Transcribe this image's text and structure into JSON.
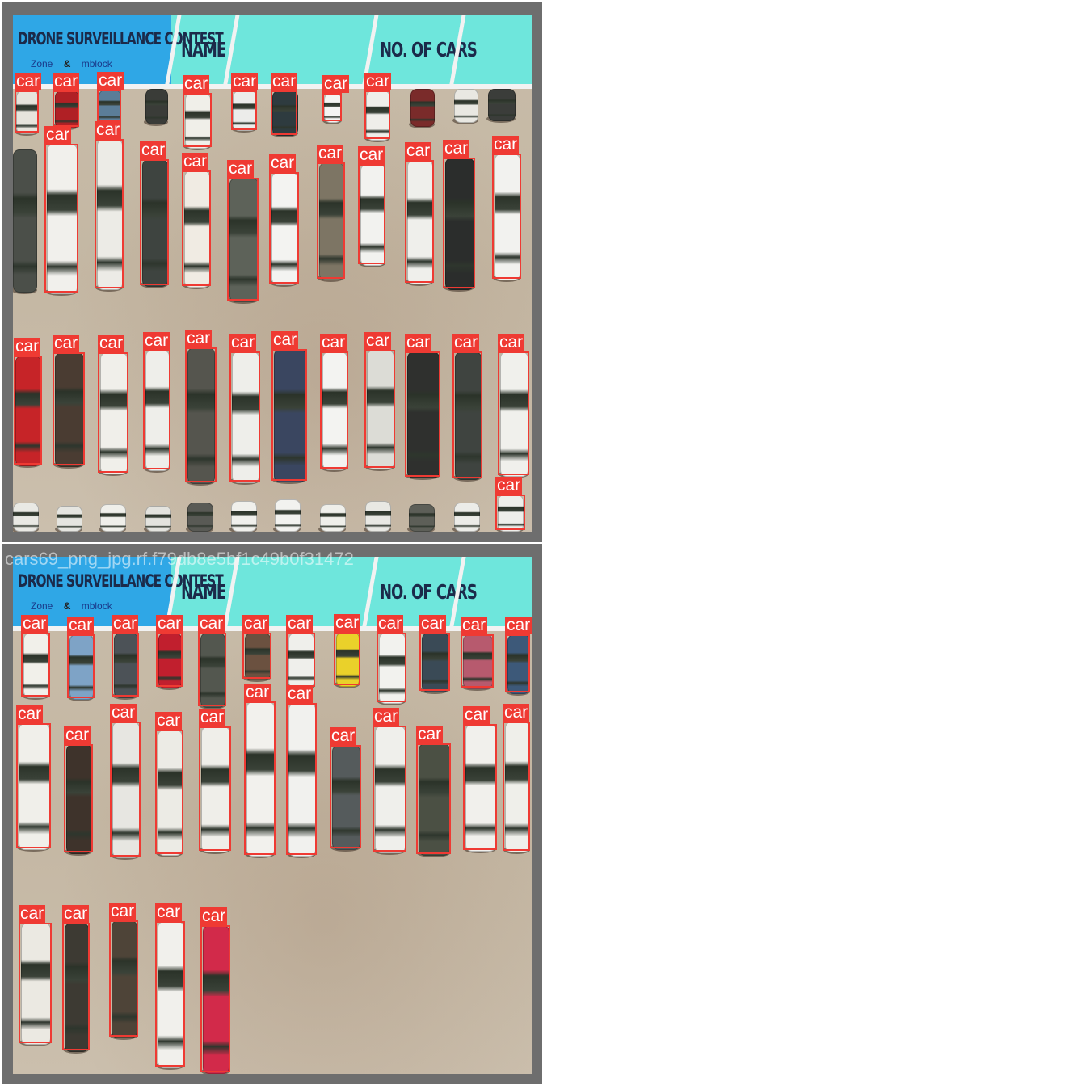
{
  "banner": {
    "title": "DRONE SURVEILLANCE CONTEST",
    "name_label": "NAME",
    "count_label": "NO. OF CARS",
    "logo_left": "Zone",
    "logo_sep": "&",
    "logo_right": "mblock"
  },
  "detection_label": "car",
  "bottom_caption": "cars69_png_jpg.rf.f79db8e5bf1c49b0f31472",
  "colors": {
    "box": "#ef3a33",
    "label_text": "#ffffff",
    "frame": "#6e6e6e"
  },
  "panels": [
    {
      "id": "top",
      "detections": [
        [
          18,
          112,
          48,
          164
        ],
        [
          65,
          112,
          98,
          157
        ],
        [
          120,
          111,
          150,
          151
        ],
        [
          226,
          115,
          262,
          182
        ],
        [
          286,
          112,
          318,
          161
        ],
        [
          335,
          112,
          368,
          167
        ],
        [
          399,
          115,
          423,
          150
        ],
        [
          451,
          112,
          483,
          172
        ],
        [
          55,
          178,
          97,
          362
        ],
        [
          117,
          172,
          153,
          357
        ],
        [
          173,
          197,
          209,
          353
        ],
        [
          225,
          211,
          261,
          354
        ],
        [
          281,
          220,
          320,
          372
        ],
        [
          333,
          213,
          370,
          351
        ],
        [
          392,
          201,
          427,
          345
        ],
        [
          443,
          203,
          477,
          327
        ],
        [
          501,
          198,
          537,
          350
        ],
        [
          548,
          195,
          588,
          357
        ],
        [
          609,
          190,
          645,
          345
        ],
        [
          17,
          440,
          52,
          575
        ],
        [
          65,
          436,
          105,
          576
        ],
        [
          121,
          436,
          159,
          585
        ],
        [
          177,
          433,
          211,
          581
        ],
        [
          229,
          430,
          268,
          597
        ],
        [
          284,
          435,
          322,
          596
        ],
        [
          336,
          432,
          380,
          595
        ],
        [
          396,
          435,
          431,
          580
        ],
        [
          451,
          433,
          489,
          579
        ],
        [
          501,
          435,
          545,
          590
        ],
        [
          560,
          435,
          597,
          592
        ],
        [
          616,
          435,
          655,
          588
        ],
        [
          613,
          612,
          650,
          656
        ]
      ],
      "cars": [
        [
          20,
          112,
          26,
          52,
          "#e7e4dc"
        ],
        [
          68,
          112,
          28,
          45,
          "#b02025"
        ],
        [
          122,
          111,
          26,
          40,
          "#5b7d98"
        ],
        [
          180,
          110,
          26,
          42,
          "#3a3c38"
        ],
        [
          229,
          115,
          30,
          67,
          "#f0efe9"
        ],
        [
          288,
          112,
          28,
          48,
          "#ececea"
        ],
        [
          337,
          112,
          30,
          54,
          "#2e3b3f"
        ],
        [
          401,
          115,
          20,
          35,
          "#f4f4f2"
        ],
        [
          453,
          112,
          28,
          60,
          "#efeeea"
        ],
        [
          508,
          110,
          28,
          45,
          "#7a2b2a"
        ],
        [
          562,
          110,
          28,
          40,
          "#e9e8e2"
        ],
        [
          604,
          110,
          32,
          38,
          "#3b3d3a"
        ],
        [
          16,
          185,
          28,
          175,
          "#4b4f49"
        ],
        [
          58,
          178,
          36,
          184,
          "#f1f0ec"
        ],
        [
          120,
          172,
          30,
          185,
          "#ecebe6"
        ],
        [
          176,
          197,
          30,
          156,
          "#3e4440"
        ],
        [
          228,
          211,
          30,
          143,
          "#f0ebe3"
        ],
        [
          284,
          220,
          34,
          152,
          "#5d6259"
        ],
        [
          336,
          213,
          31,
          138,
          "#f3f3f1"
        ],
        [
          395,
          201,
          29,
          144,
          "#7d7564"
        ],
        [
          446,
          203,
          29,
          124,
          "#f2f2ef"
        ],
        [
          504,
          198,
          30,
          152,
          "#efefeb"
        ],
        [
          551,
          195,
          34,
          162,
          "#2b2d2c"
        ],
        [
          612,
          190,
          30,
          155,
          "#f2f2ef"
        ],
        [
          19,
          440,
          30,
          135,
          "#c62428"
        ],
        [
          68,
          436,
          34,
          140,
          "#4a3c32"
        ],
        [
          124,
          436,
          32,
          149,
          "#f0efea"
        ],
        [
          180,
          433,
          28,
          148,
          "#eeeeea"
        ],
        [
          232,
          430,
          32,
          167,
          "#55554e"
        ],
        [
          287,
          435,
          32,
          161,
          "#eeeeea"
        ],
        [
          339,
          432,
          38,
          163,
          "#3a4660"
        ],
        [
          399,
          435,
          29,
          145,
          "#f3f3f1"
        ],
        [
          454,
          433,
          32,
          146,
          "#dcdcd6"
        ],
        [
          504,
          435,
          38,
          155,
          "#2f302e"
        ],
        [
          563,
          435,
          31,
          157,
          "#3f4440"
        ],
        [
          619,
          435,
          33,
          153,
          "#f0f0ec"
        ],
        [
          16,
          622,
          30,
          34,
          "#e9e9e4"
        ],
        [
          70,
          626,
          30,
          30,
          "#e5e5e0"
        ],
        [
          124,
          624,
          30,
          32,
          "#efefea"
        ],
        [
          180,
          626,
          30,
          30,
          "#e3e3de"
        ],
        [
          232,
          622,
          30,
          34,
          "#595a55"
        ],
        [
          286,
          620,
          30,
          36,
          "#f0f0ec"
        ],
        [
          340,
          618,
          30,
          38,
          "#f2f2ef"
        ],
        [
          396,
          624,
          30,
          32,
          "#efefea"
        ],
        [
          452,
          620,
          30,
          36,
          "#e8e8e3"
        ],
        [
          506,
          624,
          30,
          32,
          "#5d5f58"
        ],
        [
          562,
          622,
          30,
          34,
          "#ecece8"
        ],
        [
          616,
          612,
          30,
          44,
          "#eeeeea"
        ]
      ]
    },
    {
      "id": "bottom",
      "detections": [
        [
          26,
          783,
          62,
          862
        ],
        [
          83,
          785,
          117,
          864
        ],
        [
          138,
          783,
          172,
          862
        ],
        [
          193,
          783,
          226,
          850
        ],
        [
          245,
          783,
          280,
          874
        ],
        [
          300,
          783,
          336,
          840
        ],
        [
          354,
          783,
          390,
          850
        ],
        [
          413,
          782,
          446,
          848
        ],
        [
          466,
          783,
          503,
          869
        ],
        [
          519,
          783,
          557,
          855
        ],
        [
          570,
          785,
          611,
          851
        ],
        [
          625,
          785,
          656,
          857
        ],
        [
          20,
          895,
          63,
          1050
        ],
        [
          79,
          921,
          115,
          1055
        ],
        [
          136,
          893,
          174,
          1060
        ],
        [
          192,
          903,
          227,
          1057
        ],
        [
          246,
          899,
          286,
          1053
        ],
        [
          302,
          868,
          341,
          1058
        ],
        [
          354,
          870,
          392,
          1058
        ],
        [
          408,
          922,
          447,
          1050
        ],
        [
          461,
          898,
          503,
          1054
        ],
        [
          515,
          920,
          558,
          1057
        ],
        [
          573,
          896,
          615,
          1052
        ],
        [
          622,
          893,
          656,
          1053
        ],
        [
          23,
          1142,
          64,
          1291
        ],
        [
          77,
          1142,
          111,
          1300
        ],
        [
          135,
          1139,
          171,
          1283
        ],
        [
          192,
          1140,
          229,
          1320
        ],
        [
          248,
          1145,
          285,
          1327
        ]
      ],
      "cars": [
        [
          29,
          783,
          30,
          79,
          "#f1f0ea"
        ],
        [
          86,
          785,
          28,
          79,
          "#7ea3c6"
        ],
        [
          141,
          783,
          28,
          79,
          "#4c5257"
        ],
        [
          196,
          783,
          27,
          67,
          "#c11f2e"
        ],
        [
          248,
          783,
          29,
          91,
          "#53574f"
        ],
        [
          303,
          783,
          30,
          57,
          "#6b5140"
        ],
        [
          357,
          783,
          30,
          67,
          "#efefeb"
        ],
        [
          416,
          782,
          27,
          66,
          "#ead12a"
        ],
        [
          469,
          783,
          31,
          86,
          "#f2f2ee"
        ],
        [
          522,
          783,
          32,
          72,
          "#3a4a56"
        ],
        [
          573,
          785,
          35,
          66,
          "#b75a6e"
        ],
        [
          628,
          785,
          26,
          72,
          "#3d5979"
        ],
        [
          23,
          895,
          37,
          155,
          "#f0efea"
        ],
        [
          82,
          921,
          30,
          134,
          "#3e332b"
        ],
        [
          139,
          893,
          32,
          167,
          "#e7e6e1"
        ],
        [
          195,
          903,
          29,
          154,
          "#ecebe5"
        ],
        [
          249,
          899,
          34,
          154,
          "#efeee9"
        ],
        [
          305,
          868,
          33,
          190,
          "#f2f1ed"
        ],
        [
          357,
          870,
          32,
          188,
          "#f1f1ee"
        ],
        [
          411,
          922,
          33,
          128,
          "#555b5c"
        ],
        [
          464,
          898,
          36,
          156,
          "#efefeb"
        ],
        [
          518,
          920,
          37,
          137,
          "#4b5044"
        ],
        [
          576,
          896,
          36,
          156,
          "#f1f0ec"
        ],
        [
          625,
          893,
          29,
          160,
          "#efefea"
        ],
        [
          26,
          1142,
          35,
          149,
          "#ebe9e2"
        ],
        [
          80,
          1142,
          28,
          158,
          "#3d3a33"
        ],
        [
          138,
          1139,
          30,
          144,
          "#4e4438"
        ],
        [
          195,
          1140,
          31,
          180,
          "#f1f0ec"
        ],
        [
          251,
          1145,
          31,
          182,
          "#d22a4a"
        ]
      ]
    }
  ]
}
